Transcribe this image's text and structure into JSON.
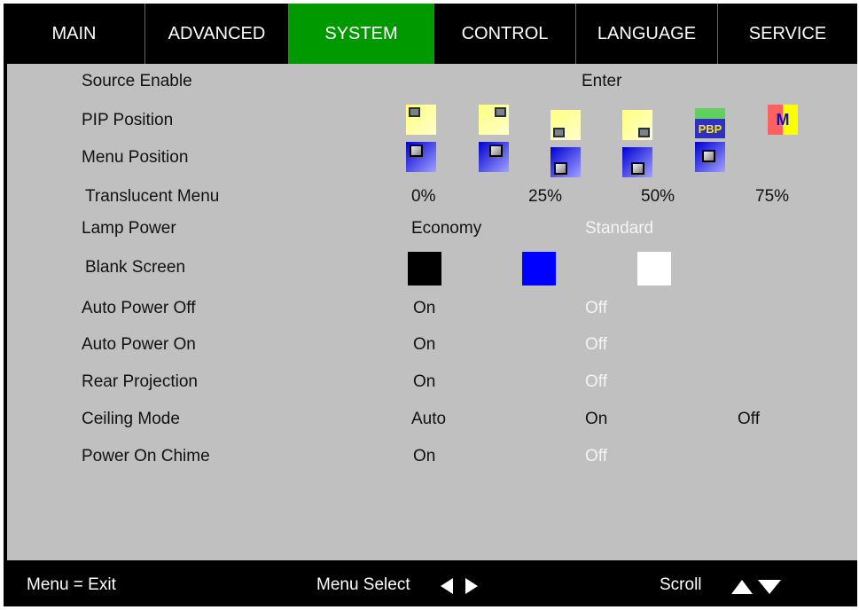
{
  "tabs": [
    {
      "label": "MAIN",
      "active": false
    },
    {
      "label": "ADVANCED",
      "active": false
    },
    {
      "label": "SYSTEM",
      "active": true
    },
    {
      "label": "CONTROL",
      "active": false
    },
    {
      "label": "LANGUAGE",
      "active": false
    },
    {
      "label": "SERVICE",
      "active": false
    }
  ],
  "rows": {
    "source_enable": {
      "label": "Source Enable",
      "options": [
        "Enter"
      ]
    },
    "pip_position": {
      "label": "PIP Position",
      "icons": [
        "pip-top-left-icon",
        "pip-top-right-icon",
        "pip-bottom-left-icon",
        "pip-bottom-right-icon",
        "pbp-icon",
        "pip-m-icon"
      ],
      "pbp_text": "PBP",
      "m_text": "M"
    },
    "menu_position": {
      "label": "Menu Position",
      "icons": [
        "menu-top-left-icon",
        "menu-top-right-icon",
        "menu-bottom-left-icon",
        "menu-bottom-right-icon",
        "menu-center-icon"
      ]
    },
    "translucent_menu": {
      "label": "Translucent Menu",
      "options": [
        "0%",
        "25%",
        "50%",
        "75%"
      ]
    },
    "lamp_power": {
      "label": "Lamp Power",
      "options": [
        "Economy",
        "Standard"
      ],
      "selected": "Standard"
    },
    "blank_screen": {
      "label": "Blank Screen",
      "swatches": [
        "#000000",
        "#0000ff",
        "#ffffff"
      ]
    },
    "auto_power_off": {
      "label": "Auto Power Off",
      "options": [
        "On",
        "Off"
      ],
      "selected": "Off"
    },
    "auto_power_on": {
      "label": "Auto Power On",
      "options": [
        "On",
        "Off"
      ],
      "selected": "Off"
    },
    "rear_projection": {
      "label": "Rear Projection",
      "options": [
        "On",
        "Off"
      ],
      "selected": "Off"
    },
    "ceiling_mode": {
      "label": "Ceiling Mode",
      "options": [
        "Auto",
        "On",
        "Off"
      ]
    },
    "power_on_chime": {
      "label": "Power On Chime",
      "options": [
        "On",
        "Off"
      ],
      "selected": "Off"
    }
  },
  "footer": {
    "exit": "Menu = Exit",
    "select": "Menu Select",
    "scroll": "Scroll"
  },
  "colors": {
    "active_tab": "#009a00",
    "panel": "#c0c0c0",
    "selected_text": "#f4f4f4"
  }
}
